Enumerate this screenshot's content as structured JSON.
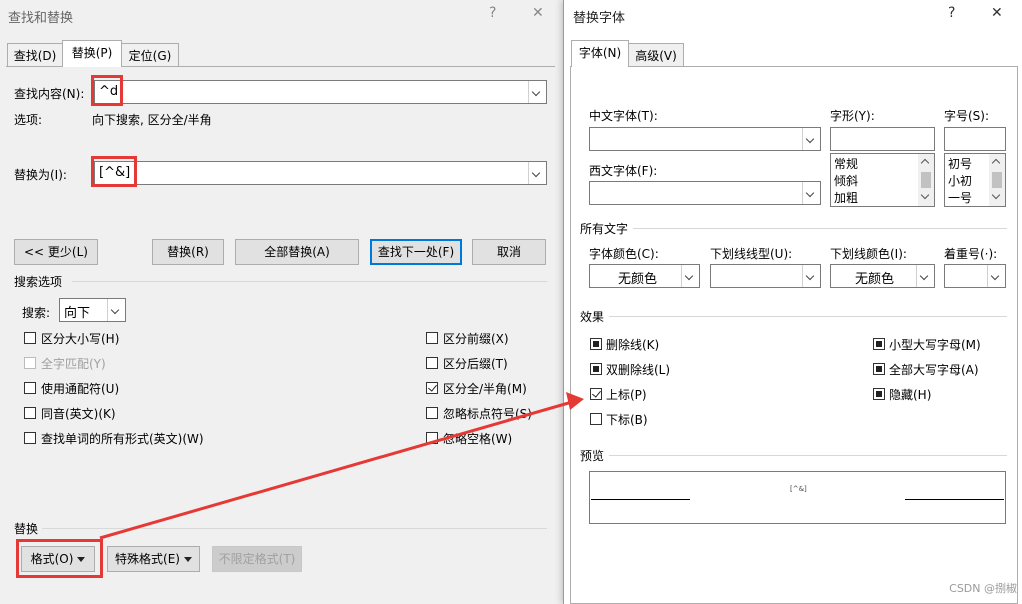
{
  "left_dialog": {
    "title": "查找和替换",
    "help": "?",
    "close": "✕",
    "tabs": [
      "查找(D)",
      "替换(P)",
      "定位(G)"
    ],
    "find_label": "查找内容(N):",
    "find_value": "^d",
    "options_label": "选项:",
    "options_value": "向下搜索, 区分全/半角",
    "replace_label": "替换为(I):",
    "replace_value": "[^&]",
    "buttons": {
      "less": "<< 更少(L)",
      "replace": "替换(R)",
      "replace_all": "全部替换(A)",
      "find_next": "查找下一处(F)",
      "cancel": "取消"
    },
    "search_options_title": "搜索选项",
    "search_label": "搜索:",
    "search_value": "向下",
    "left_checks": [
      {
        "label": "区分大小写(H)",
        "checked": false,
        "disabled": false
      },
      {
        "label": "全字匹配(Y)",
        "checked": false,
        "disabled": true
      },
      {
        "label": "使用通配符(U)",
        "checked": false,
        "disabled": false
      },
      {
        "label": "同音(英文)(K)",
        "checked": false,
        "disabled": false
      },
      {
        "label": "查找单词的所有形式(英文)(W)",
        "checked": false,
        "disabled": false
      }
    ],
    "right_checks": [
      {
        "label": "区分前缀(X)",
        "checked": false
      },
      {
        "label": "区分后缀(T)",
        "checked": false
      },
      {
        "label": "区分全/半角(M)",
        "checked": true
      },
      {
        "label": "忽略标点符号(S)",
        "checked": false
      },
      {
        "label": "忽略空格(W)",
        "checked": false
      }
    ],
    "replace_section_title": "替换",
    "bottom_buttons": {
      "format": "格式(O)",
      "special": "特殊格式(E)",
      "no_format": "不限定格式(T)"
    }
  },
  "right_dialog": {
    "title": "替换字体",
    "help": "?",
    "close": "✕",
    "tabs": [
      "字体(N)",
      "高级(V)"
    ],
    "cn_font_label": "中文字体(T):",
    "style_label": "字形(Y):",
    "size_label": "字号(S):",
    "west_font_label": "西文字体(F):",
    "style_list": [
      "常规",
      "倾斜",
      "加粗"
    ],
    "size_list": [
      "初号",
      "小初",
      "一号"
    ],
    "all_text_title": "所有文字",
    "font_color_label": "字体颜色(C):",
    "font_color_value": "无颜色",
    "underline_type_label": "下划线线型(U):",
    "underline_color_label": "下划线颜色(I):",
    "underline_color_value": "无颜色",
    "emphasis_label": "着重号(·):",
    "effects_title": "效果",
    "effects_left": [
      {
        "label": "删除线(K)",
        "state": "indeterminate"
      },
      {
        "label": "双删除线(L)",
        "state": "indeterminate"
      },
      {
        "label": "上标(P)",
        "state": "checked"
      },
      {
        "label": "下标(B)",
        "state": "unchecked"
      }
    ],
    "effects_right": [
      {
        "label": "小型大写字母(M)",
        "state": "indeterminate"
      },
      {
        "label": "全部大写字母(A)",
        "state": "indeterminate"
      },
      {
        "label": "隐藏(H)",
        "state": "indeterminate"
      }
    ],
    "preview_title": "预览",
    "preview_text": "[^&]",
    "watermark": "CSDN @捌椒"
  },
  "annotation_color": "#e53935"
}
